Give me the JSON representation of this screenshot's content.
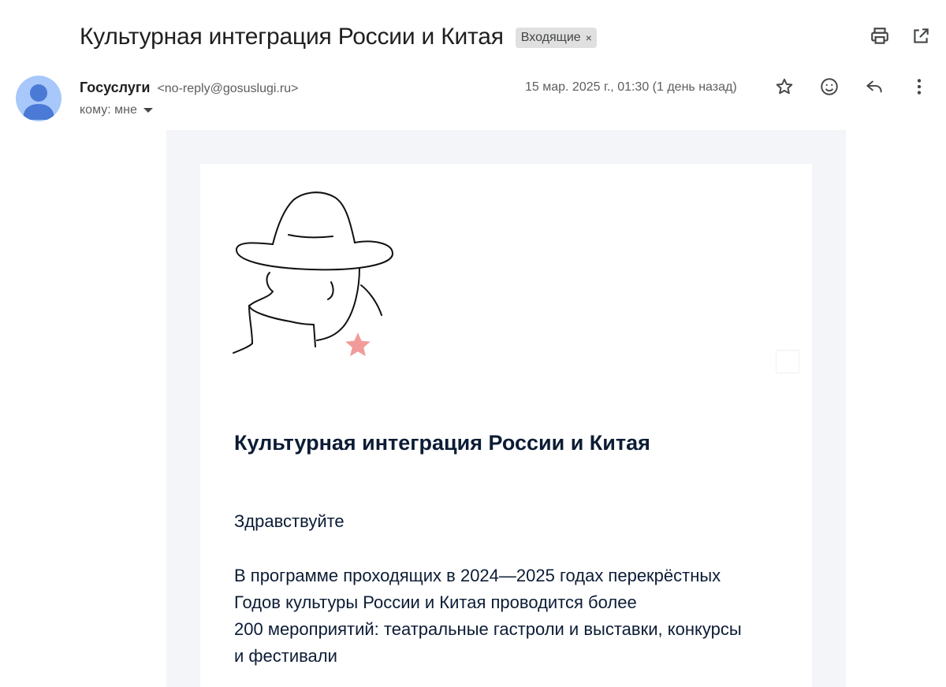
{
  "email": {
    "subject": "Культурная интеграция России и Китая",
    "label": "Входящие",
    "label_remove": "×",
    "sender_name": "Госуслуги",
    "sender_email": "<no-reply@gosuslugi.ru>",
    "recipient": "кому: мне",
    "date": "15 мар. 2025 г., 01:30 (1 день назад)"
  },
  "toolbar": {
    "icons": [
      "print-icon",
      "open-in-new-window-icon"
    ]
  },
  "message_actions": {
    "icons": [
      "star-icon",
      "emoji-reaction-icon",
      "reply-icon",
      "more-options-icon"
    ]
  },
  "body": {
    "title": "Культурная интеграция России и Китая",
    "greeting": "Здравствуйте",
    "paragraph_lines": [
      "В программе проходящих в 2024—2025 годах перекрёстных",
      "Годов культуры России и Китая проводится более",
      "200 мероприятий: театральные гастроли и выставки, конкурсы",
      "и фестивали"
    ]
  },
  "colors": {
    "avatar_bg": "#a8c7fa",
    "avatar_fg": "#4a7ad6",
    "mail_bg": "#f4f5f8",
    "title_color": "#0c1c35",
    "star_accent": "#f19b9b"
  }
}
